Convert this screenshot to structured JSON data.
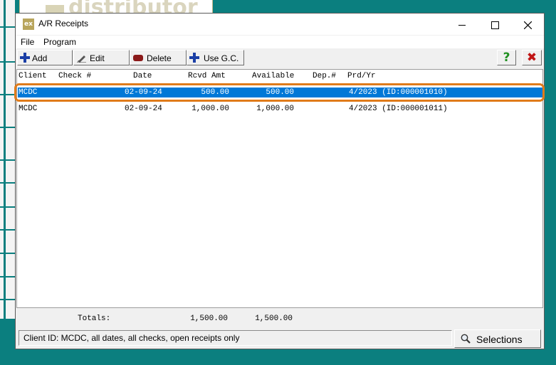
{
  "background": {
    "logo_text": "distributor"
  },
  "window": {
    "title": "A/R Receipts",
    "app_icon_text": "ex"
  },
  "menu": {
    "file": "File",
    "program": "Program"
  },
  "toolbar": {
    "add": "Add",
    "edit": "Edit",
    "delete": "Delete",
    "use_gc": "Use G.C.",
    "help": "?",
    "exit": "✖"
  },
  "table": {
    "columns": {
      "client": "Client",
      "check": "Check #",
      "date": "Date",
      "rcvd_amt": "Rcvd Amt",
      "available": "Available",
      "dep": "Dep.#",
      "prd_yr": "Prd/Yr"
    },
    "rows": [
      {
        "client": "MCDC",
        "check": "",
        "date": "02-09-24",
        "rcvd_amt": "500.00",
        "available": "500.00",
        "dep": "",
        "prd_yr": "4/2023 (ID:000001010)"
      },
      {
        "client": "MCDC",
        "check": "",
        "date": "02-09-24",
        "rcvd_amt": "1,000.00",
        "available": "1,000.00",
        "dep": "",
        "prd_yr": "4/2023 (ID:000001011)"
      }
    ],
    "selected_row": 0
  },
  "totals": {
    "label": "Totals:",
    "rcvd_amt": "1,500.00",
    "available": "1,500.00"
  },
  "status": {
    "text": "Client ID: MCDC, all dates, all checks, open receipts only"
  },
  "selections_button": {
    "label": "Selections"
  },
  "colors": {
    "desktop": "#0b7f7f",
    "selection_highlight": "#0078d7",
    "annotation_outline": "#e07b1a"
  }
}
